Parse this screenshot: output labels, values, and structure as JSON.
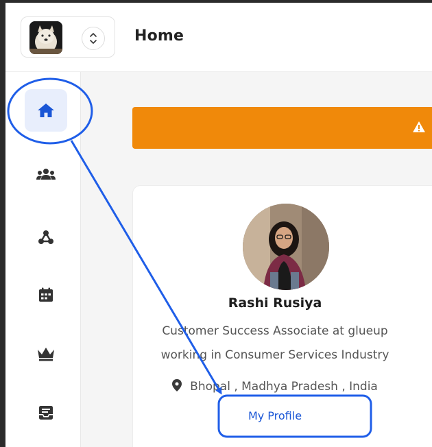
{
  "header": {
    "title": "Home",
    "org_switcher_icon": "chevron-up-down-icon",
    "org_avatar": "dog-photo"
  },
  "sidebar": {
    "items": [
      {
        "name": "home",
        "icon": "home-icon",
        "active": true
      },
      {
        "name": "members",
        "icon": "users-icon",
        "active": false
      },
      {
        "name": "network",
        "icon": "network-icon",
        "active": false
      },
      {
        "name": "events",
        "icon": "calendar-icon",
        "active": false
      },
      {
        "name": "premium",
        "icon": "crown-icon",
        "active": false
      },
      {
        "name": "inbox",
        "icon": "inbox-icon",
        "active": false
      }
    ]
  },
  "alert": {
    "icon": "warning-icon",
    "color": "#f0890a"
  },
  "profile": {
    "name": "Rashi Rusiya",
    "headline_line1": "Customer Success Associate at glueup",
    "headline_line2": "working in Consumer Services Industry",
    "location": "Bhopal , Madhya Pradesh , India",
    "link_label": "My Profile"
  },
  "colors": {
    "accent": "#1a56d6",
    "annotation": "#1f5ee8",
    "alert": "#f0890a"
  }
}
